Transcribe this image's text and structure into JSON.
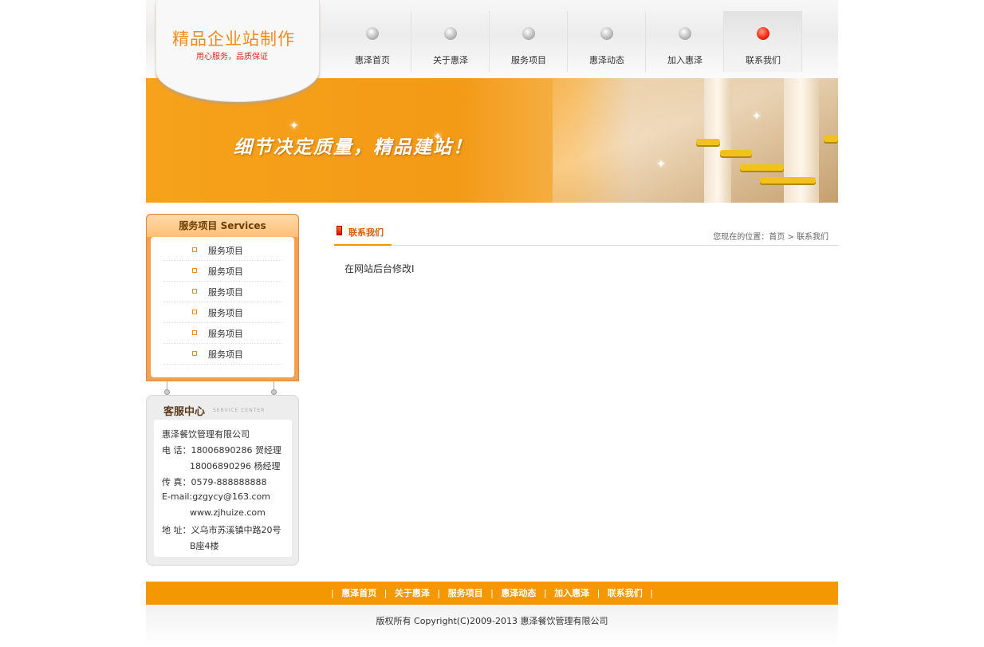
{
  "header": {
    "logo_title": "精品企业站制作",
    "logo_subtitle": "用心服务，品质保证",
    "nav": [
      {
        "label": "惠泽首页",
        "active": false
      },
      {
        "label": "关于惠泽",
        "active": false
      },
      {
        "label": "服务项目",
        "active": false
      },
      {
        "label": "惠泽动态",
        "active": false
      },
      {
        "label": "加入惠泽",
        "active": false
      },
      {
        "label": "联系我们",
        "active": true
      }
    ]
  },
  "banner": {
    "slogan": "细节决定质量，精品建站！"
  },
  "sidebar": {
    "services_title": "服务项目  Services",
    "services": [
      "服务项目",
      "服务项目",
      "服务项目",
      "服务项目",
      "服务项目",
      "服务项目"
    ],
    "cs_title": "客服中心",
    "cs_title_en": "SERVICE CENTER",
    "cs_lines": [
      "惠泽餐饮管理有限公司",
      "电 话：18006890286 贺经理",
      "18006890296 杨经理",
      "传 真：0579-888888888",
      "E-mail:gzgycy@163.com",
      "www.zjhuize.com",
      "地 址：义乌市苏溪镇中路20号",
      "B座4楼"
    ]
  },
  "main": {
    "title": "联系我们",
    "breadcrumb": "您现在的位置：首页 > 联系我们",
    "body": "在网站后台修改I"
  },
  "footer": {
    "nav": [
      "惠泽首页",
      "关于惠泽",
      "服务项目",
      "惠泽动态",
      "加入惠泽",
      "联系我们"
    ],
    "separator": "|",
    "copyright": "版权所有 Copyright(C)2009-2013 惠泽餐饮管理有限公司"
  },
  "colors": {
    "accent": "#f39800",
    "active_dot": "#ff2a10"
  }
}
